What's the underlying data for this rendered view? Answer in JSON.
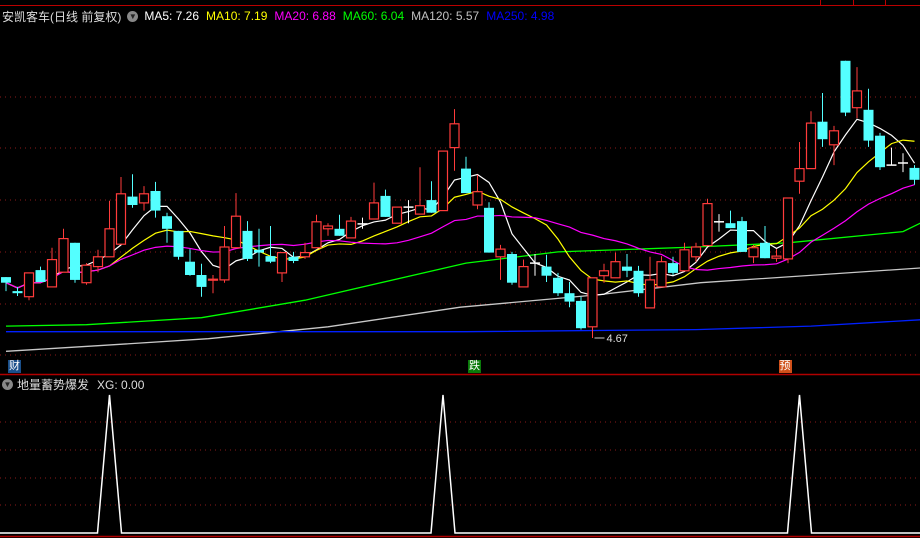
{
  "header": {
    "stock_title": "安凯客车(日线 前复权)",
    "ma_labels": [
      {
        "text": "MA5: 7.26",
        "color": "#ffffff"
      },
      {
        "text": "MA10: 7.19",
        "color": "#ffff00"
      },
      {
        "text": "MA20: 6.88",
        "color": "#ff00ff"
      },
      {
        "text": "MA60: 6.04",
        "color": "#00ff00"
      },
      {
        "text": "MA120: 5.57",
        "color": "#c0c0c0"
      },
      {
        "text": "MA250: 4.98",
        "color": "#0000ff"
      }
    ]
  },
  "signals": [
    {
      "text": "财",
      "index": 0,
      "bg": "#1a4f8a"
    },
    {
      "text": "跌",
      "index": 40,
      "bg": "#0a7a0a"
    },
    {
      "text": "预",
      "index": 67,
      "bg": "#d0501a"
    }
  ],
  "low_marker": {
    "text": "4.67",
    "index": 51
  },
  "sub_panel": {
    "title": "地量蓄势爆发",
    "value_label": "XG: 0.00"
  },
  "colors": {
    "up": "#ff3b3b",
    "down": "#54ffff",
    "flat": "#ffffff",
    "grid": "#8b1a1a",
    "frame": "#b00000"
  },
  "chart_data": [
    {
      "type": "candlestick",
      "title": "安凯客车(日线 前复权)",
      "ylim": [
        4.48,
        9.5
      ],
      "ohlc": [
        [
          5.54,
          5.54,
          5.34,
          5.46
        ],
        [
          5.34,
          5.4,
          5.27,
          5.31
        ],
        [
          5.26,
          5.6,
          5.21,
          5.6
        ],
        [
          5.64,
          5.69,
          5.47,
          5.47
        ],
        [
          5.4,
          5.96,
          5.4,
          5.79
        ],
        [
          5.61,
          6.23,
          5.61,
          6.09
        ],
        [
          6.03,
          6.03,
          5.46,
          5.5
        ],
        [
          5.46,
          5.74,
          5.43,
          5.71
        ],
        [
          5.69,
          5.93,
          5.61,
          5.83
        ],
        [
          5.83,
          6.63,
          5.83,
          6.23
        ],
        [
          6.01,
          6.97,
          6.01,
          6.73
        ],
        [
          6.69,
          7.01,
          6.53,
          6.57
        ],
        [
          6.6,
          6.84,
          6.49,
          6.73
        ],
        [
          6.77,
          6.9,
          6.39,
          6.49
        ],
        [
          6.41,
          6.46,
          6.03,
          6.23
        ],
        [
          6.2,
          6.2,
          5.79,
          5.83
        ],
        [
          5.76,
          5.94,
          5.56,
          5.57
        ],
        [
          5.57,
          5.73,
          5.26,
          5.4
        ],
        [
          5.5,
          5.57,
          5.31,
          5.51
        ],
        [
          5.5,
          6.27,
          5.46,
          5.97
        ],
        [
          5.96,
          6.74,
          5.96,
          6.41
        ],
        [
          6.2,
          6.34,
          5.77,
          5.8
        ],
        [
          5.93,
          6.23,
          5.69,
          5.89
        ],
        [
          5.84,
          6.27,
          5.74,
          5.76
        ],
        [
          5.6,
          5.89,
          5.47,
          5.89
        ],
        [
          5.83,
          5.9,
          5.74,
          5.77
        ],
        [
          5.83,
          6.03,
          5.8,
          5.89
        ],
        [
          5.96,
          6.43,
          5.96,
          6.33
        ],
        [
          6.23,
          6.31,
          6.13,
          6.27
        ],
        [
          6.23,
          6.43,
          6.13,
          6.13
        ],
        [
          6.1,
          6.4,
          6.1,
          6.34
        ],
        [
          6.3,
          6.39,
          6.23,
          6.3
        ],
        [
          6.37,
          6.89,
          6.37,
          6.6
        ],
        [
          6.7,
          6.79,
          6.4,
          6.4
        ],
        [
          6.31,
          6.54,
          6.31,
          6.54
        ],
        [
          6.54,
          6.64,
          6.31,
          6.54
        ],
        [
          6.44,
          7.11,
          6.44,
          6.56
        ],
        [
          6.64,
          6.91,
          6.46,
          6.46
        ],
        [
          6.49,
          7.34,
          6.49,
          7.34
        ],
        [
          7.39,
          7.94,
          7.06,
          7.73
        ],
        [
          7.09,
          7.26,
          6.74,
          6.74
        ],
        [
          6.57,
          7.0,
          6.51,
          6.76
        ],
        [
          6.53,
          6.61,
          5.89,
          5.89
        ],
        [
          5.83,
          6.0,
          5.5,
          5.94
        ],
        [
          5.87,
          5.9,
          5.43,
          5.46
        ],
        [
          5.4,
          5.79,
          5.4,
          5.69
        ],
        [
          5.74,
          5.87,
          5.56,
          5.74
        ],
        [
          5.69,
          5.86,
          5.47,
          5.56
        ],
        [
          5.53,
          5.6,
          5.27,
          5.31
        ],
        [
          5.31,
          5.47,
          5.11,
          5.19
        ],
        [
          5.2,
          5.26,
          4.79,
          4.81
        ],
        [
          4.83,
          5.53,
          4.67,
          5.53
        ],
        [
          5.56,
          5.73,
          5.46,
          5.63
        ],
        [
          5.53,
          5.89,
          5.53,
          5.76
        ],
        [
          5.69,
          5.87,
          5.54,
          5.63
        ],
        [
          5.63,
          5.7,
          5.26,
          5.31
        ],
        [
          5.1,
          5.83,
          5.1,
          5.5
        ],
        [
          5.4,
          5.84,
          5.4,
          5.76
        ],
        [
          5.74,
          5.83,
          5.57,
          5.6
        ],
        [
          5.63,
          6.03,
          5.63,
          5.93
        ],
        [
          5.83,
          6.03,
          5.76,
          5.97
        ],
        [
          5.99,
          6.66,
          5.99,
          6.59
        ],
        [
          6.33,
          6.44,
          6.19,
          6.33
        ],
        [
          6.31,
          6.49,
          6.24,
          6.24
        ],
        [
          6.34,
          6.4,
          5.9,
          5.9
        ],
        [
          5.83,
          6.0,
          5.74,
          5.96
        ],
        [
          6.03,
          6.27,
          5.81,
          5.81
        ],
        [
          5.81,
          5.94,
          5.76,
          5.84
        ],
        [
          5.8,
          6.67,
          5.74,
          6.67
        ],
        [
          6.91,
          7.47,
          6.73,
          7.09
        ],
        [
          7.09,
          7.91,
          7.09,
          7.74
        ],
        [
          7.76,
          8.17,
          7.4,
          7.51
        ],
        [
          7.43,
          7.7,
          7.14,
          7.63
        ],
        [
          8.63,
          8.63,
          7.84,
          7.89
        ],
        [
          7.96,
          8.54,
          7.81,
          8.2
        ],
        [
          7.93,
          8.23,
          7.4,
          7.49
        ],
        [
          7.56,
          7.6,
          7.07,
          7.11
        ],
        [
          7.14,
          7.39,
          7.14,
          7.14
        ],
        [
          7.17,
          7.31,
          7.04,
          7.17
        ],
        [
          7.1,
          7.14,
          6.86,
          6.93
        ]
      ],
      "computed_ma": [
        {
          "name": "MA5",
          "period": 5,
          "color": "#ffffff"
        },
        {
          "name": "MA10",
          "period": 10,
          "color": "#ffff00"
        },
        {
          "name": "MA20",
          "period": 20,
          "color": "#ff00ff"
        }
      ],
      "long_ma": [
        {
          "name": "MA60",
          "color": "#00ff00",
          "points": [
            [
              0,
              4.84
            ],
            [
              7,
              4.86
            ],
            [
              17,
              4.96
            ],
            [
              26,
              5.21
            ],
            [
              40,
              5.74
            ],
            [
              48,
              5.9
            ],
            [
              60,
              5.97
            ],
            [
              68,
              6.03
            ],
            [
              78,
              6.19
            ],
            [
              79.5,
              6.31
            ]
          ]
        },
        {
          "name": "MA120",
          "color": "#c8c8c8",
          "points": [
            [
              0,
              4.48
            ],
            [
              8,
              4.56
            ],
            [
              17.6,
              4.66
            ],
            [
              28,
              4.83
            ],
            [
              39.5,
              5.11
            ],
            [
              51.6,
              5.29
            ],
            [
              60.4,
              5.46
            ],
            [
              79.5,
              5.67
            ]
          ]
        },
        {
          "name": "MA250",
          "color": "#0020ff",
          "points": [
            [
              0,
              4.76
            ],
            [
              40,
              4.76
            ],
            [
              60,
              4.79
            ],
            [
              70,
              4.84
            ],
            [
              79.5,
              4.93
            ]
          ]
        }
      ]
    },
    {
      "type": "line",
      "title": "地量蓄势爆发",
      "series": [
        {
          "name": "XG",
          "signal_indices": [
            9,
            38,
            69
          ]
        }
      ],
      "ylim": [
        0,
        1
      ]
    }
  ]
}
